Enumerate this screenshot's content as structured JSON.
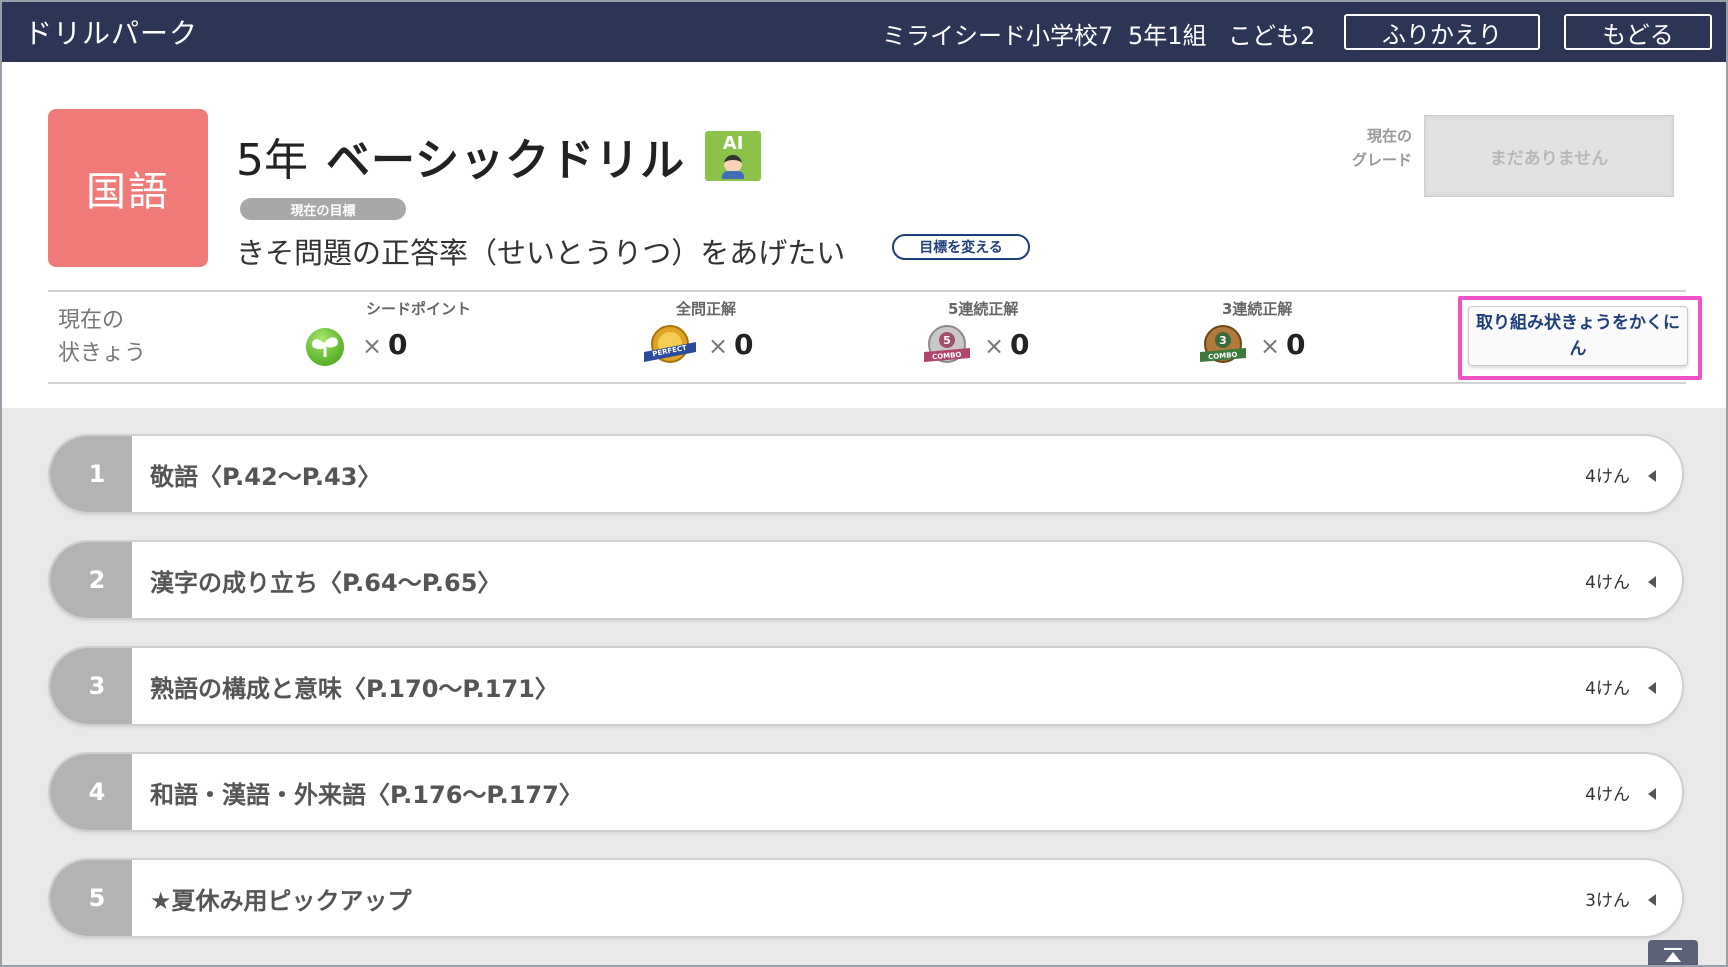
{
  "app": {
    "title": "ドリルパーク"
  },
  "header": {
    "school": "ミライシード小学校7",
    "class": "5年1組",
    "student": "こども2",
    "review_button": "ふりかえり",
    "back_button": "もどる"
  },
  "drill": {
    "subject": "国語",
    "grade": "5年",
    "name": "ベーシックドリル",
    "ai_badge": "AI",
    "goal_tag": "現在の目標",
    "goal_text": "きそ問題の正答率（せいとうりつ）をあげたい",
    "change_goal_button": "目標を変える",
    "current_grade_caption_1": "現在の",
    "current_grade_caption_2": "グレード",
    "current_grade_value": "まだありません"
  },
  "status": {
    "label_1": "現在の",
    "label_2": "状きょう",
    "stats": [
      {
        "caption": "シードポイント",
        "icon": "sprout-icon",
        "x": "×",
        "value": "0"
      },
      {
        "caption": "全問正解",
        "icon": "perfect-medal-icon",
        "x": "×",
        "value": "0"
      },
      {
        "caption": "5連続正解",
        "icon": "5-combo-medal-icon",
        "x": "×",
        "value": "0"
      },
      {
        "caption": "3連続正解",
        "icon": "3-combo-medal-icon",
        "x": "×",
        "value": "0"
      }
    ],
    "progress_button": "取り組み状きょうをかくにん",
    "highlight_color": "#f052c8"
  },
  "units": [
    {
      "num": "1",
      "title": "敬語〈P.42～P.43〉",
      "count": "4けん"
    },
    {
      "num": "2",
      "title": "漢字の成り立ち〈P.64～P.65〉",
      "count": "4けん"
    },
    {
      "num": "3",
      "title": "熟語の構成と意味〈P.170～P.171〉",
      "count": "4けん"
    },
    {
      "num": "4",
      "title": "和語・漢語・外来語〈P.176～P.177〉",
      "count": "4けん"
    },
    {
      "num": "5",
      "title": "★夏休み用ピックアップ",
      "count": "3けん"
    }
  ],
  "colors": {
    "topbar": "#2c3556",
    "subject": "#f07a78",
    "ai_badge": "#8bc34a",
    "link": "#1f3f7a"
  }
}
